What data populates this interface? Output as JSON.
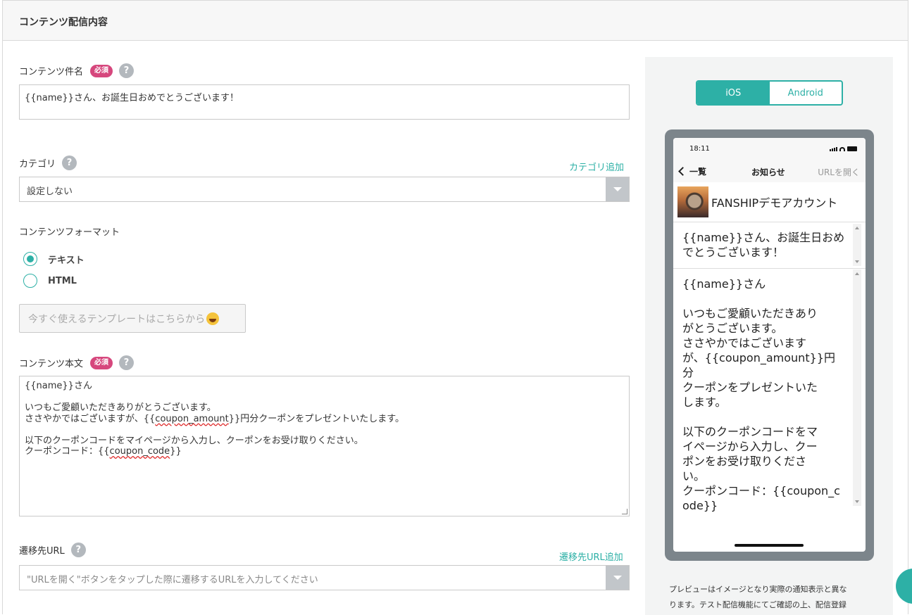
{
  "section": {
    "title": "コンテンツ配信内容"
  },
  "subject": {
    "label": "コンテンツ件名",
    "required": "必須",
    "help": "?",
    "value": "{{name}}さん、お誕生日おめでとうございます！"
  },
  "category": {
    "label": "カテゴリ",
    "help": "?",
    "add_link": "カテゴリ追加",
    "selected": "設定しない"
  },
  "format": {
    "label": "コンテンツフォーマット",
    "options": [
      {
        "label": "テキスト",
        "selected": true
      },
      {
        "label": "HTML",
        "selected": false
      }
    ],
    "template_button": "今すぐ使えるテンプレートはこちらから",
    "template_icon": "grinning-face-emoji"
  },
  "body": {
    "label": "コンテンツ本文",
    "required": "必須",
    "help": "?",
    "lines": [
      "{{name}}さん",
      "",
      "いつもご愛顧いただきありがとうございます。",
      "ささやかではございますが、{{coupon_amount}}円分クーポンをプレゼントいたします。",
      "",
      "以下のクーポンコードをマイページから入力し、クーポンをお受け取りください。",
      "クーポンコード：{{coupon_code}}"
    ]
  },
  "url": {
    "label": "遷移先URL",
    "help": "?",
    "add_link": "遷移先URL追加",
    "placeholder": "\"URLを開く\"ボタンをタップした際に遷移するURLを入力してください"
  },
  "preview": {
    "tabs": {
      "ios": "iOS",
      "android": "Android",
      "active": "ios"
    },
    "status_time": "18:11",
    "nav_back": "一覧",
    "nav_title": "お知らせ",
    "nav_action": "URLを開く",
    "sender_name": "FANSHIPデモアカウント",
    "title_lines": [
      "{{name}}さん、お誕生日おめ",
      "でとうございます！"
    ],
    "body_lines": [
      "{{name}}さん",
      "",
      "いつもご愛顧いただきあり",
      "がとうございます。",
      "ささやかではございます",
      "が、{{coupon_amount}}円分",
      "クーポンをプレゼントいた",
      "します。",
      "",
      "以下のクーポンコードをマ",
      "イページから入力し、クー",
      "ポンをお受け取りくださ",
      "い。",
      "クーポンコード：{{coupon_c",
      "ode}}"
    ],
    "note_lines": [
      "プレビューはイメージとなり実際の通知表示と異な",
      "ります。テスト配信機能にてご確認の上、配信登録"
    ]
  },
  "colors": {
    "accent": "#2db0a6",
    "required_badge": "#d6477d"
  }
}
